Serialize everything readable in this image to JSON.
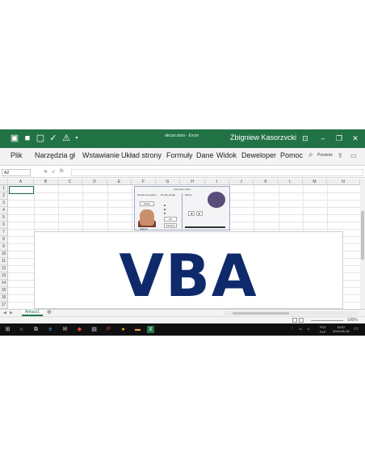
{
  "window": {
    "doc_title": "akcan.xlsm  -  Excel",
    "user": "Zbigniew Kasorzvcki",
    "min_icon": "minimize-icon",
    "restore_icon": "restore-icon",
    "close_icon": "close-icon"
  },
  "ribbon": {
    "tabs": [
      "Plik",
      "Narzędzia gł",
      "Wstawianie",
      "Układ strony",
      "Formuły",
      "Dane",
      "Widok",
      "Deweloper",
      "Pomoc"
    ],
    "tell_me": "Powiedz"
  },
  "formula_bar": {
    "name_box": "A2",
    "fx": "fx",
    "cancel": "✕",
    "enter": "✓"
  },
  "grid": {
    "columns": [
      "A",
      "B",
      "C",
      "D",
      "E",
      "F",
      "G",
      "H",
      "I",
      "J",
      "K",
      "L",
      "M",
      "N"
    ],
    "rows": [
      "1",
      "2",
      "3",
      "4",
      "5",
      "6",
      "7",
      "8",
      "9",
      "10",
      "11",
      "12",
      "13",
      "14",
      "15",
      "16",
      "17",
      "18",
      "19"
    ]
  },
  "form": {
    "title": "Formularz okno",
    "label_left": "Ta lista do wyboru",
    "label_mid": "Do listy dodaj",
    "label_right": "Wybór",
    "button_photo": "Obraz",
    "button_ok": "OK",
    "button_cancel": "Zamknij",
    "caption": "Zdjęcie"
  },
  "banner": {
    "text": "VBA"
  },
  "sheets": {
    "tabs": [
      "Arkusz1"
    ],
    "add": "⊕"
  },
  "status": {
    "zoom": "100%"
  },
  "taskbar": {
    "lang": "POL",
    "layout": "PLP",
    "time": "16:57",
    "date": "2019-05-15"
  },
  "colors": {
    "excel_green": "#217346",
    "vba_blue": "#0e2a6b",
    "taskbar": "#101010"
  }
}
